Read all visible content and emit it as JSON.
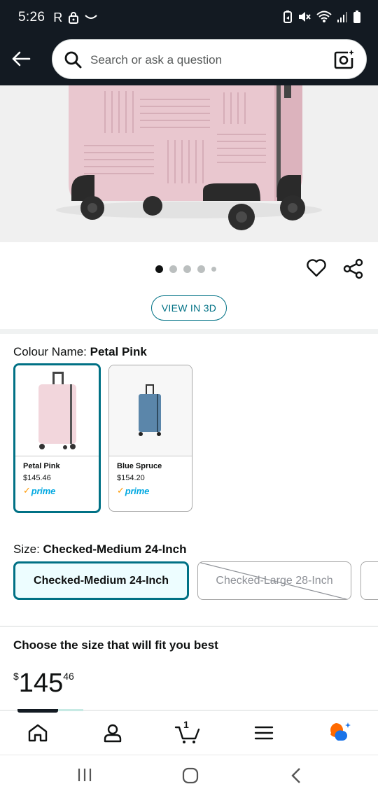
{
  "status_bar": {
    "time": "5:26",
    "carrier_letter": "R"
  },
  "header": {
    "search_placeholder": "Search or ask a question"
  },
  "gallery": {
    "image_count": 5,
    "active_index": 0,
    "view_3d_label": "VIEW IN 3D"
  },
  "colour": {
    "label": "Colour Name:",
    "selected": "Petal Pink",
    "options": [
      {
        "name": "Petal Pink",
        "price": "$145.46",
        "badge": "prime",
        "color": "#f2d6dc"
      },
      {
        "name": "Blue Spruce",
        "price": "$154.20",
        "badge": "prime",
        "color": "#5b86aa"
      }
    ]
  },
  "size": {
    "label": "Size:",
    "selected": "Checked-Medium 24-Inch",
    "options": [
      {
        "label": "Checked-Medium 24-Inch",
        "state": "selected"
      },
      {
        "label": "Checked-Large 28-Inch",
        "state": "unavailable"
      }
    ]
  },
  "fit": {
    "heading": "Choose the size that will fit you best"
  },
  "price": {
    "symbol": "$",
    "whole": "145",
    "fraction": "46"
  },
  "bottom_nav": {
    "cart_count": "1",
    "items": [
      "home-icon",
      "account-icon",
      "cart-icon",
      "menu-icon",
      "rufus-icon"
    ]
  },
  "colors": {
    "header_bg": "#131a22",
    "accent": "#007185",
    "prime_blue": "#00a8e1",
    "prime_check": "#ff9900"
  }
}
